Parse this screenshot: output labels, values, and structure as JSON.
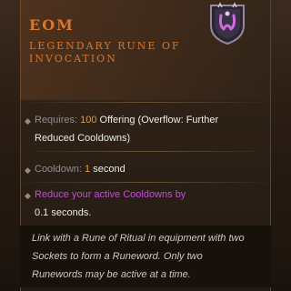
{
  "item": {
    "name": "EOM",
    "type_line1": "LEGENDARY RUNE OF",
    "type_line2": "INVOCATION",
    "icon": "rune-eom-icon"
  },
  "requires": {
    "label": "Requires: ",
    "amount": "100",
    "text_line1": " Offering (Overflow: Further",
    "text_line2": "Reduced Cooldowns)"
  },
  "cooldown": {
    "label": "Cooldown: ",
    "amount": "1",
    "unit": " second"
  },
  "effect": {
    "line1": "Reduce your active Cooldowns by",
    "line2_value": "0.1",
    "line2_unit": " seconds."
  },
  "flavor": {
    "line1": "Link with a Rune of Ritual in equipment with two",
    "line2": "Sockets to form a Runeword. Only two",
    "line3": "Runewords may be active at a time."
  },
  "colors": {
    "legendary": "#d8762c",
    "highlight": "#e0963a",
    "magic": "#c44cd6"
  }
}
